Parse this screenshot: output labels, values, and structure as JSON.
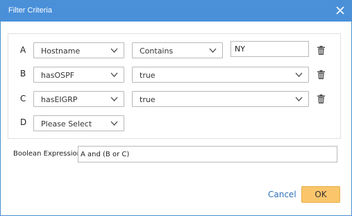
{
  "dialog": {
    "title": "Filter Criteria",
    "close_icon": "close-icon"
  },
  "rows": [
    {
      "letter": "A",
      "field": "Hostname",
      "operator": "Contains",
      "value": "NY",
      "has_delete": true
    },
    {
      "letter": "B",
      "field": "hasOSPF",
      "value_select": "true",
      "has_delete": true
    },
    {
      "letter": "C",
      "field": "hasEIGRP",
      "value_select": "true",
      "has_delete": true
    },
    {
      "letter": "D",
      "field": "Please Select",
      "has_delete": false
    }
  ],
  "boolean": {
    "label": "Boolean Expression:",
    "value": "A and (B or C)"
  },
  "footer": {
    "cancel_label": "Cancel",
    "ok_label": "OK"
  },
  "colors": {
    "titlebar": "#4a90d9",
    "ok_button": "#fbc66b",
    "link": "#2d6fb7"
  }
}
